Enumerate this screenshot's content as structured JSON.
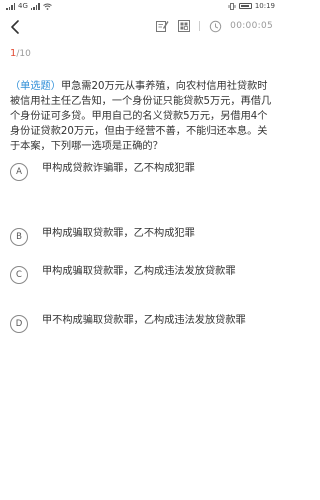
{
  "status_bar": {
    "network_label": "4G",
    "time": "10:19",
    "battery_icon": "battery-icon"
  },
  "toolbar": {
    "back_icon": "back-arrow-icon",
    "edit_icon": "edit-note-icon",
    "grid_icon": "answer-sheet-icon",
    "timer_icon": "clock-icon",
    "timer": "00:00:05"
  },
  "progress": {
    "current": "1",
    "total": "/10"
  },
  "question": {
    "type": "（单选题）",
    "text": "甲急需20万元从事养殖，向农村信用社贷款时被信用社主任乙告知，一个身份证只能贷款5万元，再借几个身份证可多贷。甲用自己的名义贷款5万元，另借用4个身份证贷款20万元，但由于经营不善，不能归还本息。关于本案，下列哪一选项是正确的？"
  },
  "options": [
    {
      "letter": "A",
      "text": "甲构成贷款诈骗罪，乙不构成犯罪"
    },
    {
      "letter": "B",
      "text": "甲构成骗取贷款罪，乙不构成犯罪"
    },
    {
      "letter": "C",
      "text": "甲构成骗取贷款罪，乙构成违法发放贷款罪"
    },
    {
      "letter": "D",
      "text": "甲不构成骗取贷款罪，乙构成违法发放贷款罪"
    }
  ],
  "colors": {
    "accent_red": "#e24a33",
    "accent_blue": "#2f8fd8",
    "muted": "#999999"
  }
}
